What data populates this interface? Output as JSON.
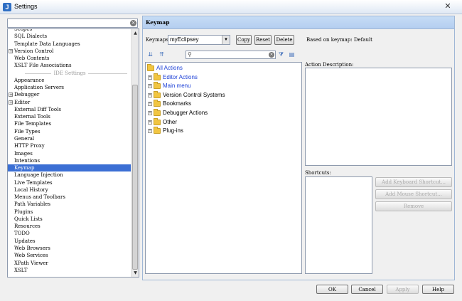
{
  "window": {
    "title": "Settings",
    "close_glyph": "✕"
  },
  "sidebar": {
    "search_value": "",
    "items": [
      {
        "label": "Scopes",
        "expandable": false
      },
      {
        "label": "SQL Dialects",
        "expandable": false
      },
      {
        "label": "Template Data Languages",
        "expandable": false
      },
      {
        "label": "Version Control",
        "expandable": true
      },
      {
        "label": "Web Contents",
        "expandable": false
      },
      {
        "label": "XSLT File Associations",
        "expandable": false
      },
      {
        "label": "IDE Settings",
        "section": true
      },
      {
        "label": "Appearance",
        "expandable": false
      },
      {
        "label": "Application Servers",
        "expandable": false
      },
      {
        "label": "Debugger",
        "expandable": true
      },
      {
        "label": "Editor",
        "expandable": true
      },
      {
        "label": "External Diff Tools",
        "expandable": false
      },
      {
        "label": "External Tools",
        "expandable": false
      },
      {
        "label": "File Templates",
        "expandable": false
      },
      {
        "label": "File Types",
        "expandable": false
      },
      {
        "label": "General",
        "expandable": false
      },
      {
        "label": "HTTP Proxy",
        "expandable": false
      },
      {
        "label": "Images",
        "expandable": false
      },
      {
        "label": "Intentions",
        "expandable": false
      },
      {
        "label": "Keymap",
        "expandable": false,
        "selected": true
      },
      {
        "label": "Language Injection",
        "expandable": false
      },
      {
        "label": "Live Templates",
        "expandable": false
      },
      {
        "label": "Local History",
        "expandable": false
      },
      {
        "label": "Menus and Toolbars",
        "expandable": false
      },
      {
        "label": "Path Variables",
        "expandable": false
      },
      {
        "label": "Plugins",
        "expandable": false
      },
      {
        "label": "Quick Lists",
        "expandable": false
      },
      {
        "label": "Resources",
        "expandable": false
      },
      {
        "label": "TODO",
        "expandable": false
      },
      {
        "label": "Updates",
        "expandable": false
      },
      {
        "label": "Web Browsers",
        "expandable": false
      },
      {
        "label": "Web Services",
        "expandable": false
      },
      {
        "label": "XPath Viewer",
        "expandable": false
      },
      {
        "label": "XSLT",
        "expandable": false
      }
    ]
  },
  "panel": {
    "title": "Keymap",
    "keymaps_label": "Keymaps",
    "keymap_value": "myEclipsey",
    "copy_label": "Copy",
    "reset_label": "Reset",
    "delete_label": "Delete",
    "based_on": "Based on keymap: Default",
    "action_description_label": "Action Description:",
    "shortcuts_label": "Shortcuts:",
    "add_keyboard_shortcut": "Add Keyboard Shortcut...",
    "add_mouse_shortcut": "Add Mouse Shortcut...",
    "remove_label": "Remove",
    "action_search_value": "",
    "actions": [
      {
        "label": "All Actions",
        "blue": true
      },
      {
        "label": "Editor Actions",
        "blue": true
      },
      {
        "label": "Main menu",
        "blue": true
      },
      {
        "label": "Version Control Systems",
        "blue": false
      },
      {
        "label": "Bookmarks",
        "blue": false
      },
      {
        "label": "Debugger Actions",
        "blue": false
      },
      {
        "label": "Other",
        "blue": false
      },
      {
        "label": "Plug-ins",
        "blue": false
      }
    ]
  },
  "footer": {
    "ok": "OK",
    "cancel": "Cancel",
    "apply": "Apply",
    "help": "Help"
  },
  "colors": {
    "selection": "#3b6fd4",
    "panel_header": "#c6dcf5",
    "link_blue": "#1b3fd6"
  }
}
